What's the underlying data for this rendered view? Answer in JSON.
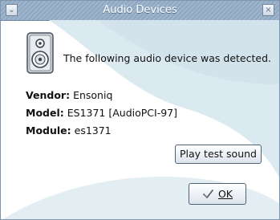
{
  "window": {
    "title": "Audio Devices",
    "menu_glyph": "⌄",
    "close_glyph": "×"
  },
  "dialog": {
    "message": "The following audio device was detected.",
    "fields": [
      {
        "key": "Vendor:",
        "value": "Ensoniq"
      },
      {
        "key": "Model:",
        "value": "ES1371 [AudioPCI-97]"
      },
      {
        "key": "Module:",
        "value": "es1371"
      }
    ]
  },
  "buttons": {
    "play_test_sound": "Play test sound",
    "ok": "OK"
  },
  "icons": {
    "speaker": "speaker-icon",
    "ok": "checkmark-icon"
  },
  "colors": {
    "titlebar": "#9fb6cd",
    "wave": "#d9e8ef",
    "button_border": "#4f6278"
  }
}
